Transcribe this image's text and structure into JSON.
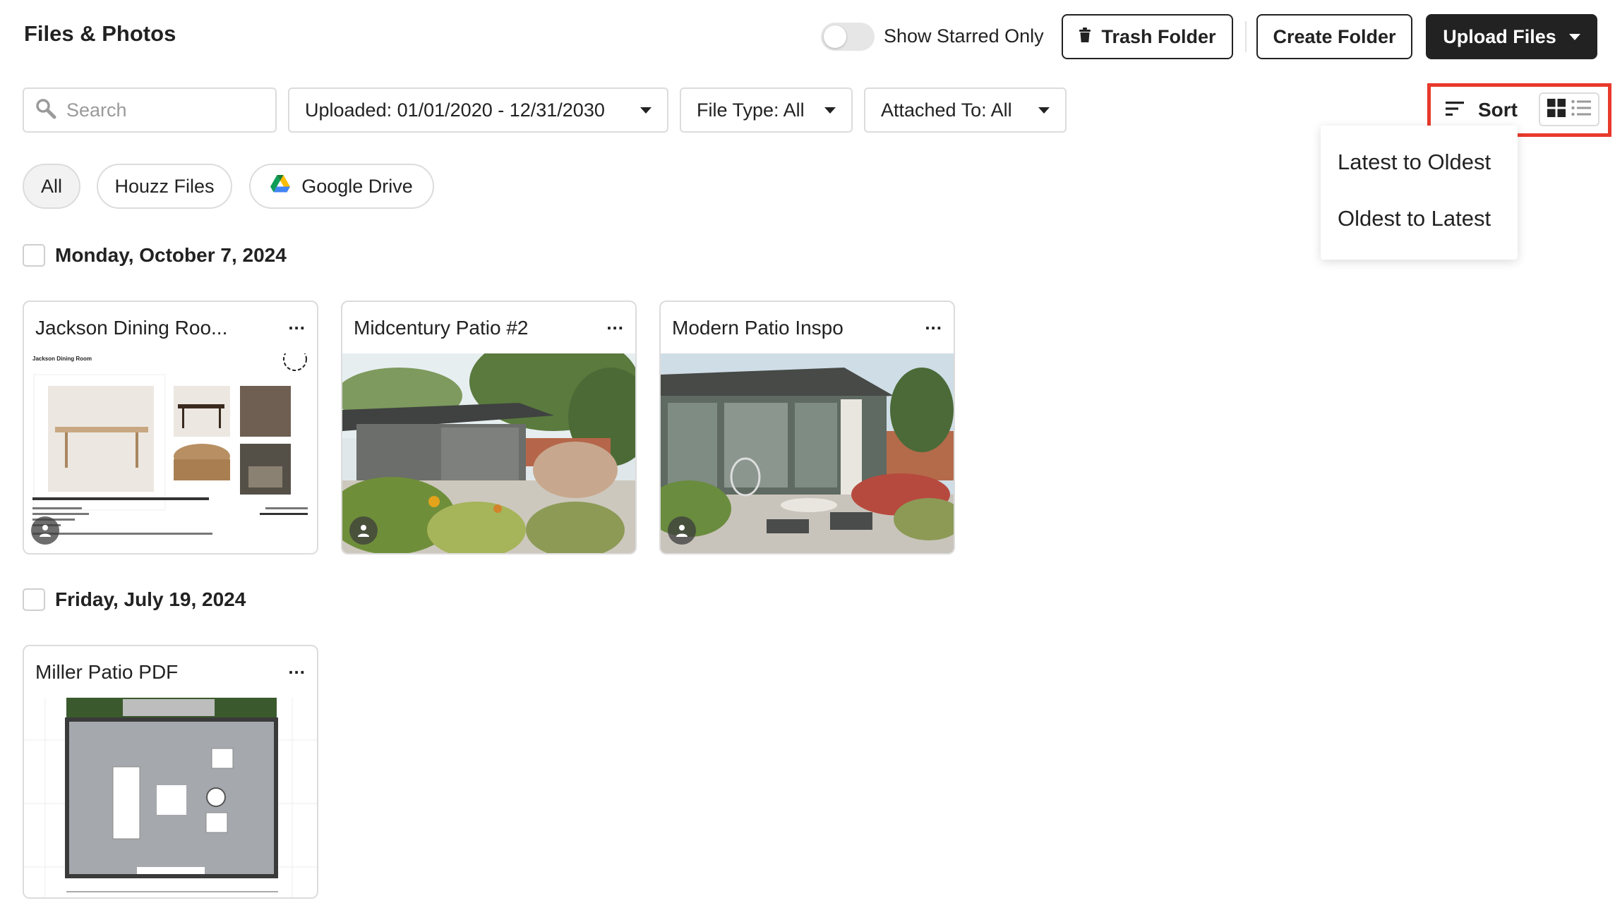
{
  "header": {
    "title": "Files & Photos",
    "starred_toggle_label": "Show Starred Only",
    "starred_toggle_on": false,
    "trash_label": "Trash Folder",
    "create_label": "Create Folder",
    "upload_label": "Upload Files"
  },
  "filters": {
    "search_placeholder": "Search",
    "search_value": "",
    "uploaded": "Uploaded: 01/01/2020 - 12/31/2030",
    "file_type": "File Type: All",
    "attached_to": "Attached To: All"
  },
  "sort": {
    "label": "Sort",
    "view_mode": "grid",
    "options": [
      "Latest to Oldest",
      "Oldest to Latest"
    ]
  },
  "sources": {
    "selected": "All",
    "chips": [
      "All",
      "Houzz Files",
      "Google Drive"
    ]
  },
  "groups": [
    {
      "date": "Monday, October 7, 2024",
      "cards": [
        {
          "title": "Jackson Dining Roo...",
          "preview_heading": "Jackson Dining Room"
        },
        {
          "title": "Midcentury Patio #2"
        },
        {
          "title": "Modern Patio Inspo"
        }
      ]
    },
    {
      "date": "Friday, July 19, 2024",
      "cards": [
        {
          "title": "Miller Patio PDF"
        }
      ]
    }
  ],
  "colors": {
    "highlight": "#e8392b",
    "primary_button": "#222222",
    "border": "#dcdcdc"
  }
}
